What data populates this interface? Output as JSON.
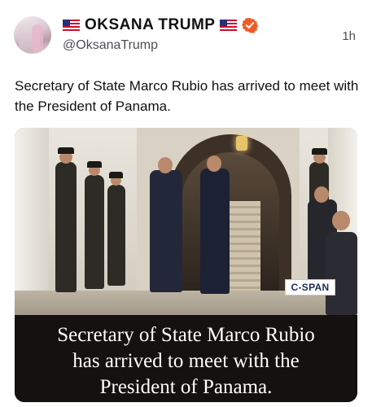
{
  "author": {
    "display_name": "OKSANA TRUMP",
    "handle": "@OksanaTrump",
    "flag_icon": "us-flag-icon",
    "verified_icon": "verified-badge-icon",
    "verified_color": "#f05a28"
  },
  "tweet": {
    "time": "1h",
    "text": "Secretary of State Marco Rubio has arrived to meet with the President of Panama."
  },
  "media": {
    "network_logo": "C-SPAN",
    "caption_lines": [
      "Secretary of State Marco Rubio",
      "has arrived to meet with the",
      "President of Panama."
    ]
  }
}
